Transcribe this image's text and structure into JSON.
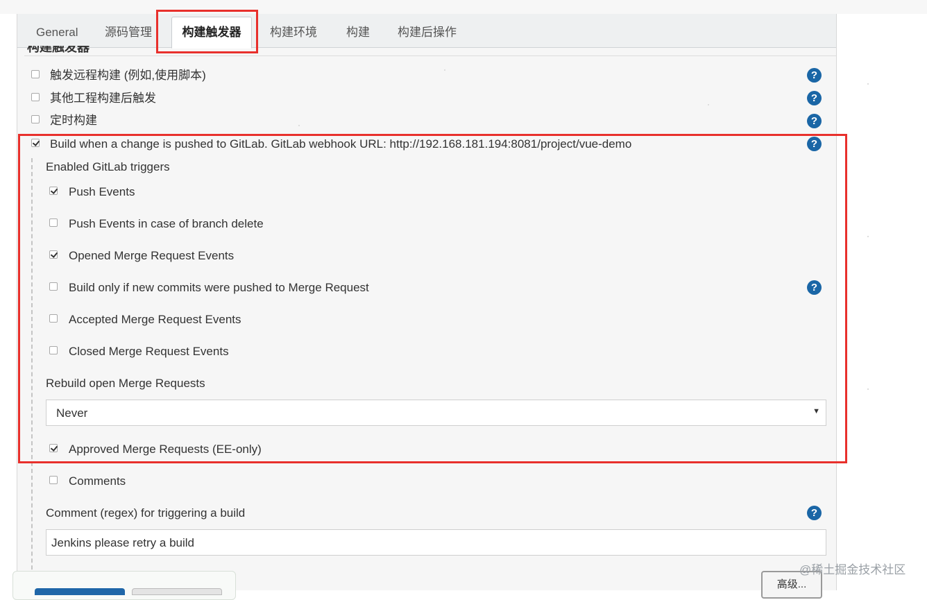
{
  "tabs": [
    {
      "label": "General"
    },
    {
      "label": "源码管理"
    },
    {
      "label": "构建触发器"
    },
    {
      "label": "构建环境"
    },
    {
      "label": "构建"
    },
    {
      "label": "构建后操作"
    }
  ],
  "active_tab": "构建触发器",
  "section_heading": "构建触发器",
  "triggers": [
    {
      "label": "触发远程构建 (例如,使用脚本)",
      "checked": false
    },
    {
      "label": "其他工程构建后触发",
      "checked": false
    },
    {
      "label": "定时构建",
      "checked": false
    },
    {
      "label": "Build when a change is pushed to GitLab. GitLab webhook URL: http://192.168.181.194:8081/project/vue-demo",
      "checked": true
    }
  ],
  "gitlab": {
    "enabled_triggers_label": "Enabled GitLab triggers",
    "options": [
      {
        "label": "Push Events",
        "checked": true
      },
      {
        "label": "Push Events in case of branch delete",
        "checked": false
      },
      {
        "label": "Opened Merge Request Events",
        "checked": true
      },
      {
        "label": "Build only if new commits were pushed to Merge Request",
        "checked": false
      },
      {
        "label": "Accepted Merge Request Events",
        "checked": false
      },
      {
        "label": "Closed Merge Request Events",
        "checked": false
      }
    ],
    "rebuild_label": "Rebuild open Merge Requests",
    "rebuild_value": "Never",
    "approved": {
      "label": "Approved Merge Requests (EE-only)",
      "checked": true
    },
    "comments": {
      "label": "Comments",
      "checked": false
    },
    "comment_regex_label": "Comment (regex) for triggering a build",
    "comment_regex_value": "Jenkins please retry a build"
  },
  "buttons": {
    "advanced": "高级..."
  },
  "help_glyph": "?",
  "watermark": "@稀土掘金技术社区",
  "colors": {
    "help_icon": "#1a66a6",
    "highlight_box": "#e8302c",
    "save_button": "#1f66a8"
  }
}
